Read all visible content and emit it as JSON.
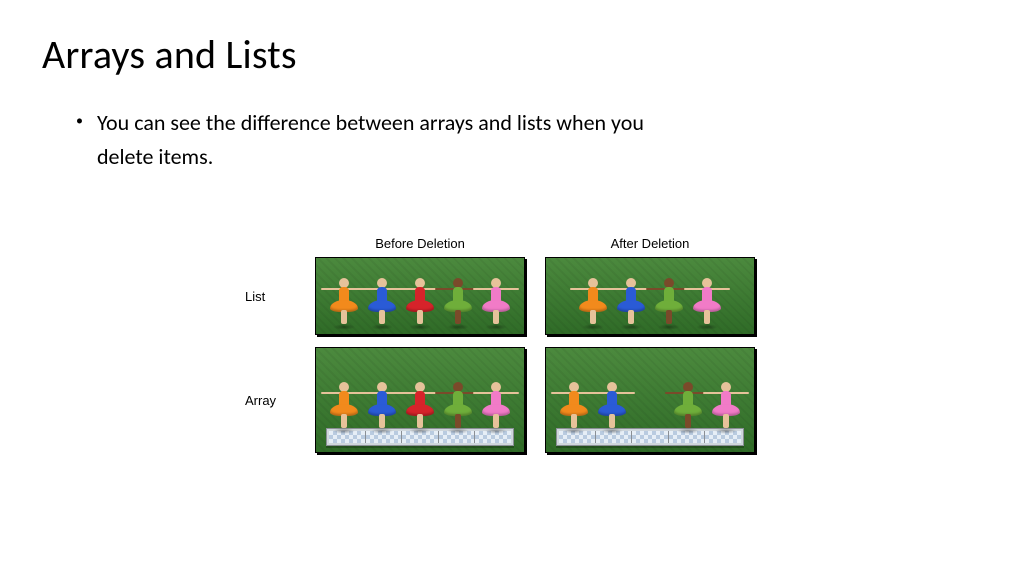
{
  "title": "Arrays and Lists",
  "bullets": [
    "You can see the difference between arrays and lists when you delete items."
  ],
  "diagram": {
    "columnHeaders": [
      "Before Deletion",
      "After Deletion"
    ],
    "rowLabels": [
      "List",
      "Array"
    ],
    "dancerColors": [
      "orange",
      "blue",
      "red",
      "green",
      "pink"
    ],
    "panels": {
      "listBefore": {
        "items": [
          "orange",
          "blue",
          "red",
          "green",
          "pink"
        ],
        "platform": false
      },
      "listAfter": {
        "items": [
          "orange",
          "blue",
          "green",
          "pink"
        ],
        "platform": false
      },
      "arrayBefore": {
        "items": [
          "orange",
          "blue",
          "red",
          "green",
          "pink"
        ],
        "platform": true,
        "slots": 5
      },
      "arrayAfter": {
        "items": [
          "orange",
          "blue",
          null,
          "green",
          "pink"
        ],
        "platform": true,
        "slots": 5
      }
    },
    "deletedIndex": 2
  }
}
